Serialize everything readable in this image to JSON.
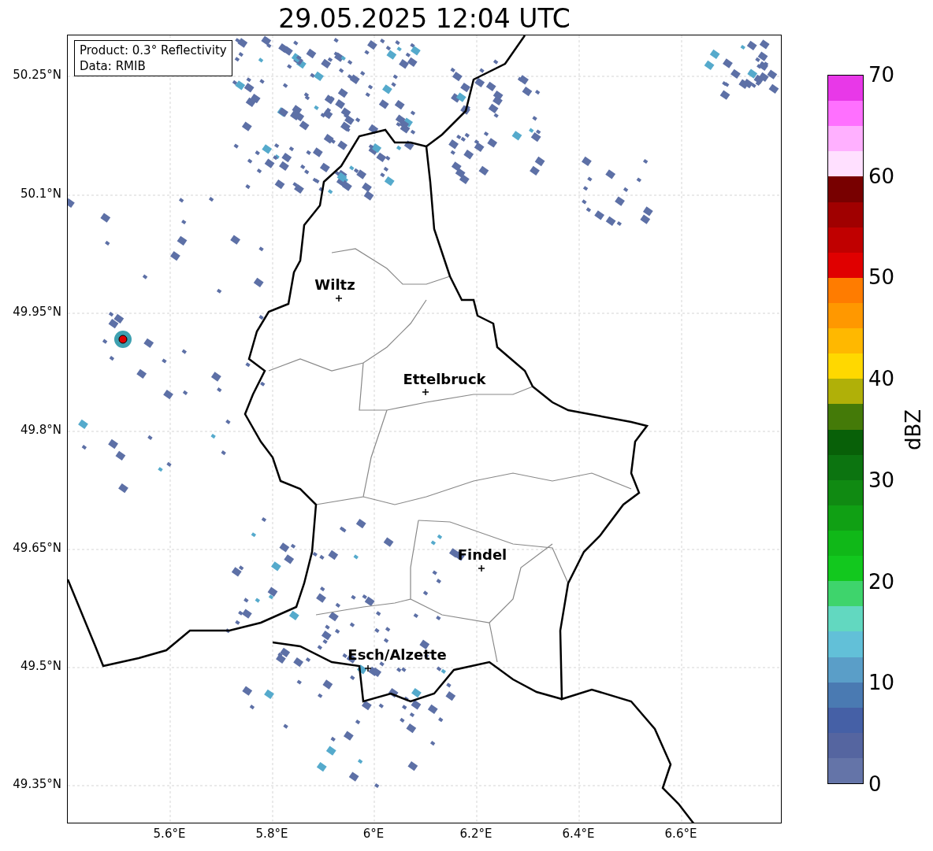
{
  "title": "29.05.2025 12:04 UTC",
  "info_box": [
    "Product: 0.3° Reflectivity",
    "Data: RMIB"
  ],
  "y_ticks": [
    "50.25°N",
    "50.1°N",
    "49.95°N",
    "49.8°N",
    "49.65°N",
    "49.5°N",
    "49.35°N"
  ],
  "x_ticks": [
    "5.6°E",
    "5.8°E",
    "6°E",
    "6.2°E",
    "6.4°E",
    "6.6°E"
  ],
  "cities": [
    {
      "name": "Wiltz"
    },
    {
      "name": "Ettelbruck"
    },
    {
      "name": "Findel"
    },
    {
      "name": "Esch/Alzette"
    }
  ],
  "colorbar": {
    "label": "dBZ",
    "ticks": [
      "70",
      "60",
      "50",
      "40",
      "30",
      "20",
      "10",
      "0"
    ],
    "bands": [
      {
        "color": "#e838e8"
      },
      {
        "color": "#ff70ff"
      },
      {
        "color": "#ffb0ff"
      },
      {
        "color": "#ffe0ff"
      },
      {
        "color": "#780000"
      },
      {
        "color": "#a00000"
      },
      {
        "color": "#c00000"
      },
      {
        "color": "#e00000"
      },
      {
        "color": "#ff7c00"
      },
      {
        "color": "#ff9800"
      },
      {
        "color": "#ffb800"
      },
      {
        "color": "#ffd800"
      },
      {
        "color": "#b0b008"
      },
      {
        "color": "#447a08"
      },
      {
        "color": "#086008"
      },
      {
        "color": "#0c7410"
      },
      {
        "color": "#108a12"
      },
      {
        "color": "#10a014"
      },
      {
        "color": "#10b818"
      },
      {
        "color": "#12c81e"
      },
      {
        "color": "#3ed46c"
      },
      {
        "color": "#62d8c0"
      },
      {
        "color": "#62c0d8"
      },
      {
        "color": "#5a9ec8"
      },
      {
        "color": "#4a7ab2"
      },
      {
        "color": "#4560a6"
      },
      {
        "color": "#5565a0"
      },
      {
        "color": "#6474a8"
      }
    ]
  }
}
